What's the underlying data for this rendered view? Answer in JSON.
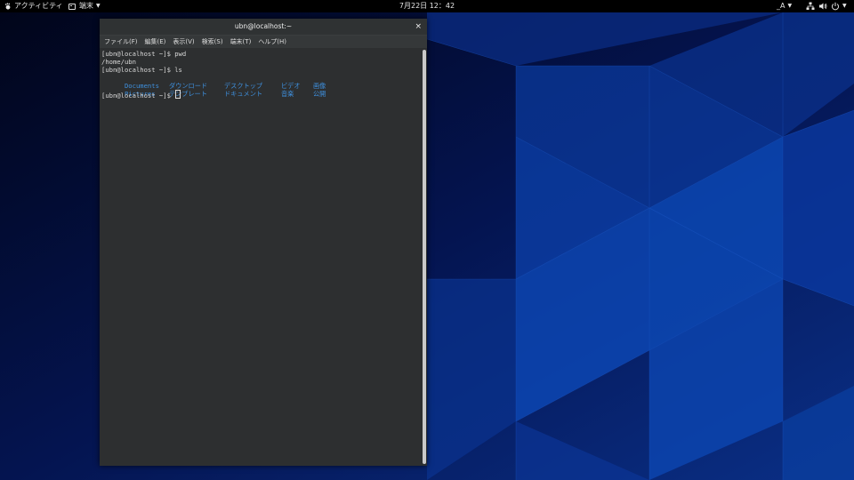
{
  "topbar": {
    "activities": "アクティビティ",
    "app_menu": "端末",
    "clock": "7月22日  12：42",
    "input_source": "_A"
  },
  "window": {
    "title": "ubn@localhost:~",
    "close": "×",
    "menus": [
      "ファイル(F)",
      "編集(E)",
      "表示(V)",
      "検索(S)",
      "端末(T)",
      "ヘルプ(H)"
    ]
  },
  "terminal": {
    "lines": [
      "[ubn@localhost ~]$ pwd",
      "/home/ubn",
      "[ubn@localhost ~]$ ls"
    ],
    "ls_row1": [
      "Documents",
      "ダウンロード",
      "デスクトップ",
      "ビデオ",
      "画像"
    ],
    "ls_row2": [
      "Pictures",
      "テンプレート",
      "ドキュメント",
      "音楽",
      "公開"
    ],
    "prompt": "[ubn@localhost ~]$ "
  },
  "colors": {
    "directory": "#3e8fdc",
    "terminal_bg": "#2d2f30",
    "wallpaper_dark": "#020a2a",
    "wallpaper_blue": "#0b47b0"
  }
}
